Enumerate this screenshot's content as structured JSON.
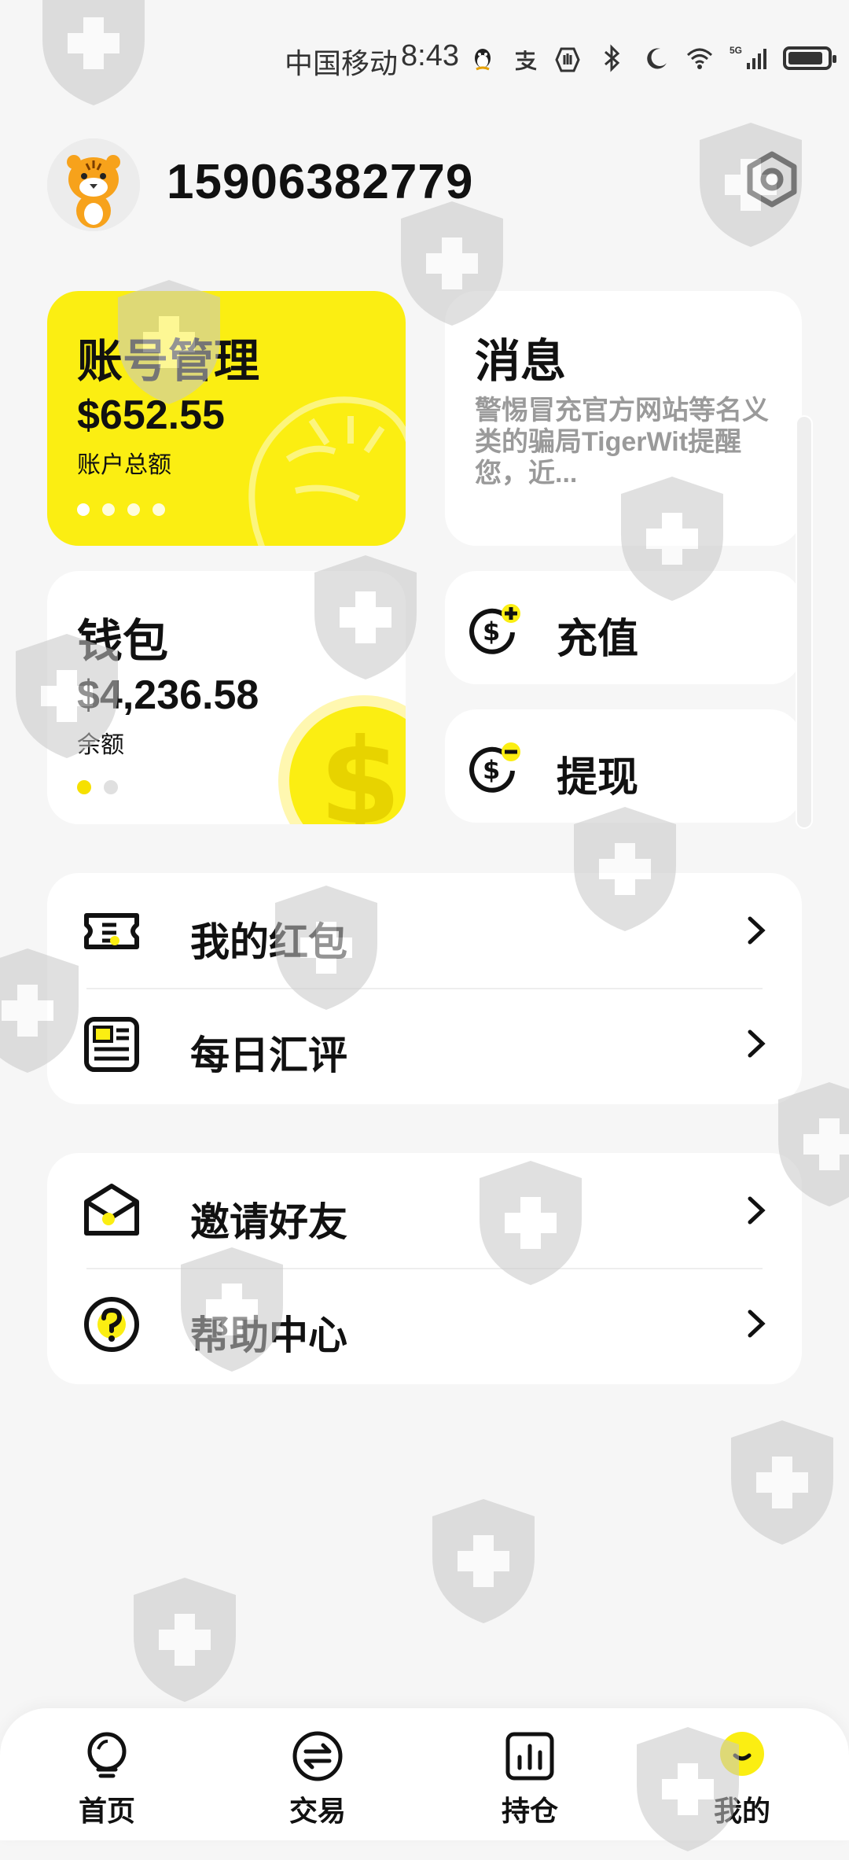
{
  "status_bar": {
    "carrier": "中国移动",
    "time": "8:43",
    "network": "5G"
  },
  "header": {
    "username": "15906382779",
    "avatar_icon": "tiger-avatar-icon",
    "settings_icon": "settings-icon"
  },
  "account_card": {
    "title": "账号管理",
    "amount": "$652.55",
    "subtitle": "账户总额",
    "slides": 4,
    "active_slide": 1
  },
  "message_card": {
    "title": "消息",
    "body": "警惕冒充官方网站等名义类的骗局TigerWit提醒您，近..."
  },
  "wallet_card": {
    "title": "钱包",
    "amount": "$4,236.58",
    "subtitle": "余额"
  },
  "actions": {
    "deposit_label": "充值",
    "withdraw_label": "提现"
  },
  "menu_group_1": [
    {
      "label": "我的红包",
      "icon": "red-envelope-icon"
    },
    {
      "label": "每日汇评",
      "icon": "daily-review-icon"
    }
  ],
  "menu_group_2": [
    {
      "label": "邀请好友",
      "icon": "invite-icon"
    },
    {
      "label": "帮助中心",
      "icon": "help-icon"
    }
  ],
  "bottom_nav": [
    {
      "label": "首页",
      "icon": "home-bulb-icon"
    },
    {
      "label": "交易",
      "icon": "trade-exchange-icon"
    },
    {
      "label": "持仓",
      "icon": "positions-chart-icon"
    },
    {
      "label": "我的",
      "icon": "profile-icon",
      "active": true
    }
  ],
  "colors": {
    "accent": "#fbee12",
    "background": "#f6f6f6",
    "card": "#ffffff",
    "muted_text": "#9a9a9a"
  }
}
